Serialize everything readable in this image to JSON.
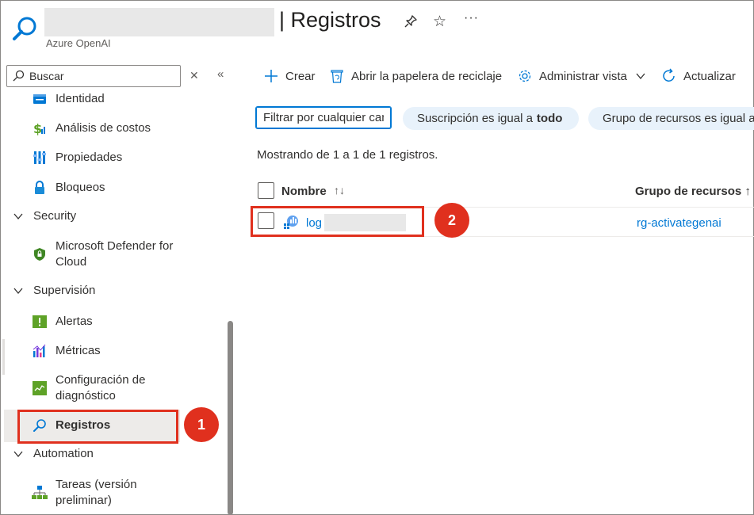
{
  "header": {
    "title": "| Registros",
    "subtitle": "Azure OpenAI",
    "pin_icon": "pin-icon",
    "star_icon": "star-icon",
    "more": "···"
  },
  "sidebar": {
    "search_placeholder": "Buscar",
    "clear": "✕",
    "collapse": "«",
    "items": [
      {
        "label": "Identidad",
        "icon": "identity-icon"
      },
      {
        "label": "Análisis de costos",
        "icon": "cost-analysis-icon"
      },
      {
        "label": "Propiedades",
        "icon": "properties-icon"
      },
      {
        "label": "Bloqueos",
        "icon": "lock-icon"
      }
    ],
    "groups": {
      "security": "Security",
      "supervision": "Supervisión",
      "automation": "Automation"
    },
    "security_items": [
      {
        "label": "Microsoft Defender for Cloud",
        "icon": "defender-icon"
      }
    ],
    "supervision_items": [
      {
        "label": "Alertas",
        "icon": "alerts-icon"
      },
      {
        "label": "Métricas",
        "icon": "metrics-icon"
      },
      {
        "label": "Configuración de diagnóstico",
        "icon": "diagnostic-settings-icon"
      },
      {
        "label": "Registros",
        "icon": "logs-icon",
        "selected": true
      }
    ],
    "automation_items": [
      {
        "label": "Tareas (versión preliminar)",
        "icon": "tasks-icon"
      }
    ]
  },
  "toolbar": {
    "create": "Crear",
    "recycle": "Abrir la papelera de reciclaje",
    "manage_view": "Administrar vista",
    "refresh": "Actualizar"
  },
  "filters": {
    "placeholder": "Filtrar por cualquier campo...",
    "subscription_prefix": "Suscripción es igual a",
    "subscription_value": "todo",
    "resource_group": "Grupo de recursos es igual a todo"
  },
  "results_text": "Mostrando de 1 a 1 de 1 registros.",
  "grid": {
    "columns": {
      "name": "Nombre",
      "name_sort": "↑↓",
      "resource_group": "Grupo de recursos ↑"
    },
    "rows": [
      {
        "name": "log",
        "resource_group": "rg-activategenai"
      }
    ]
  },
  "annotations": {
    "badge_1": "1",
    "badge_2": "2",
    "highlight_color": "#e0301e"
  },
  "colors": {
    "accent": "#0078d4",
    "pill_bg": "#e8f2fb"
  }
}
